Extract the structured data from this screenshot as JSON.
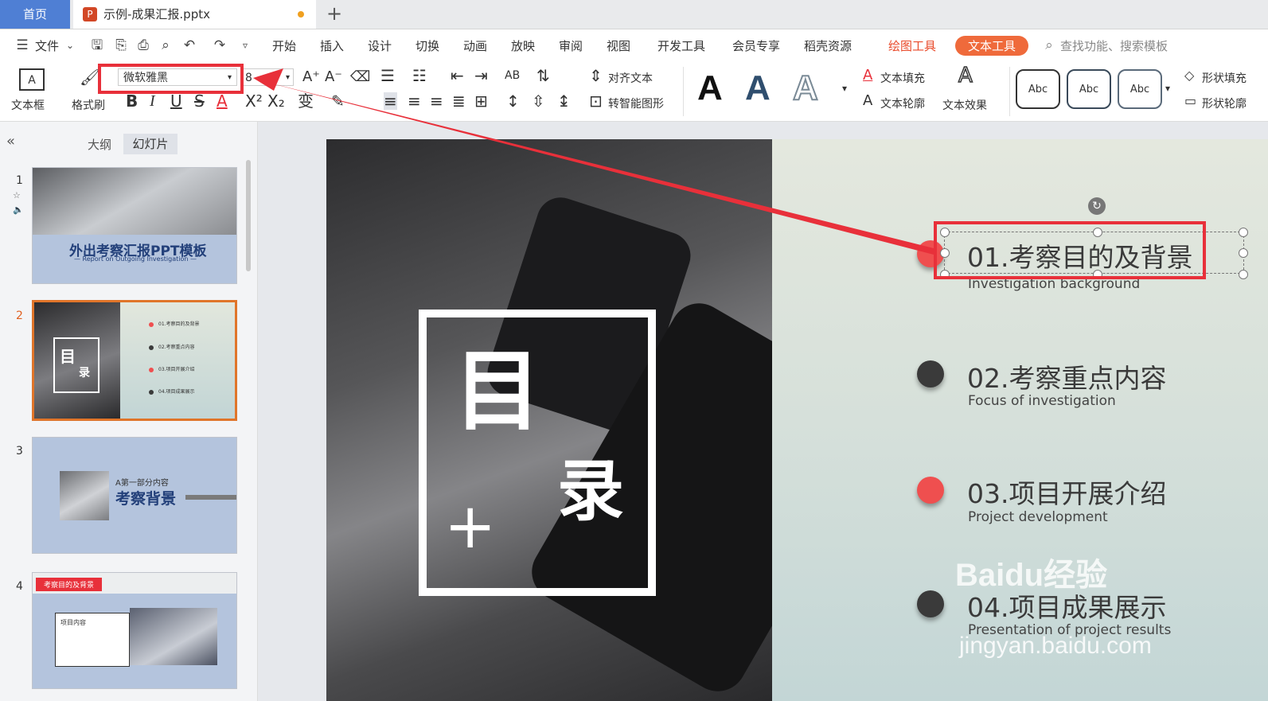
{
  "tabs": {
    "home": "首页",
    "document": "示例-成果汇报.pptx",
    "add": "+"
  },
  "menubar": {
    "file": "文件",
    "items": [
      "开始",
      "插入",
      "设计",
      "切换",
      "动画",
      "放映",
      "审阅",
      "视图",
      "开发工具",
      "会员专享",
      "稻壳资源"
    ],
    "drawing_tools": "绘图工具",
    "text_tools": "文本工具",
    "search_placeholder": "查找功能、搜索模板"
  },
  "ribbon": {
    "textbox": "文本框",
    "format_painter": "格式刷",
    "font_name": "微软雅黑",
    "font_size": "8",
    "align_text": "对齐文本",
    "smart_shape": "转智能图形",
    "text_fill": "文本填充",
    "text_outline": "文本轮廓",
    "text_effect": "文本效果",
    "shape_fill": "形状填充",
    "shape_outline": "形状轮廓",
    "style_samples": [
      "Abc",
      "Abc",
      "Abc"
    ],
    "wordart_letter": "A"
  },
  "leftpanel": {
    "outline_tab": "大纲",
    "slides_tab": "幻灯片",
    "slide_numbers": [
      "1",
      "2",
      "3",
      "4"
    ],
    "thumb1": {
      "title": "外出考察汇报PPT模板",
      "subtitle": "— Report on Outgoing Investigation —"
    },
    "thumb2": {
      "char1": "目",
      "char2": "录"
    },
    "thumb3": {
      "small": "A第一部分内容",
      "title": "考察背景"
    },
    "thumb4": {
      "tag": "考察目的及背景",
      "box_title": "项目内容"
    }
  },
  "slide": {
    "char_mu": "目",
    "char_lu": "录",
    "plus": "+",
    "items": [
      {
        "title": "01.考察目的及背景",
        "subtitle": "Investigation background"
      },
      {
        "title": "02.考察重点内容",
        "subtitle": "Focus of investigation"
      },
      {
        "title": "03.项目开展介绍",
        "subtitle": "Project development"
      },
      {
        "title": "04.项目成果展示",
        "subtitle": "Presentation of project results"
      }
    ]
  },
  "watermark": {
    "brand": "Baidu经验",
    "url": "jingyan.baidu.com"
  },
  "colors": {
    "accent_red": "#e8303a",
    "bullet_red": "#ef4f4f",
    "bullet_dark": "#3a3a3a",
    "home_tab": "#4f7fd4",
    "text_tools": "#ef6a3b"
  }
}
